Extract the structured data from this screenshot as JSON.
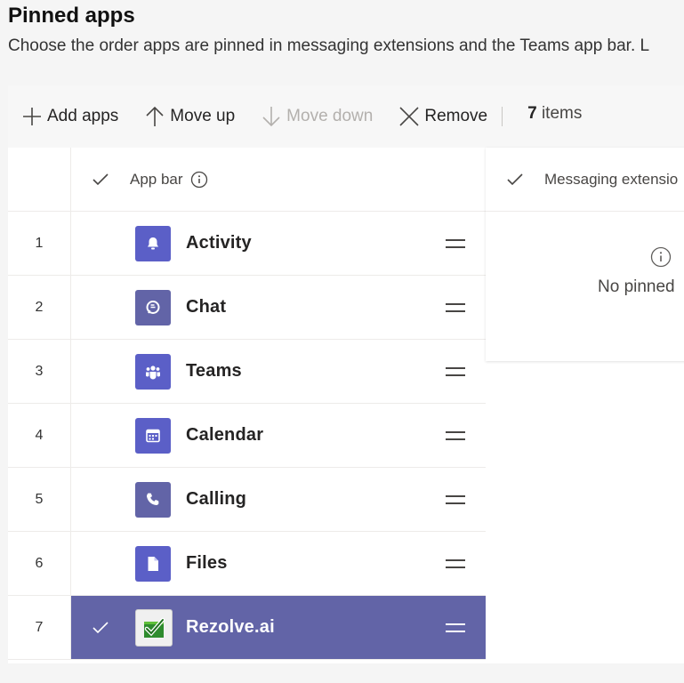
{
  "header": {
    "title": "Pinned apps",
    "subtitle": "Choose the order apps are pinned in messaging extensions and the Teams app bar. L"
  },
  "toolbar": {
    "add_label": "Add apps",
    "move_up_label": "Move up",
    "move_down_label": "Move down",
    "remove_label": "Remove",
    "count_number": "7",
    "count_suffix": " items"
  },
  "app_bar": {
    "column_label": "App bar",
    "rows": [
      {
        "num": "1",
        "name": "Activity",
        "icon": "bell-icon"
      },
      {
        "num": "2",
        "name": "Chat",
        "icon": "chat-bubble-icon"
      },
      {
        "num": "3",
        "name": "Teams",
        "icon": "teams-people-icon"
      },
      {
        "num": "4",
        "name": "Calendar",
        "icon": "calendar-icon"
      },
      {
        "num": "5",
        "name": "Calling",
        "icon": "phone-icon"
      },
      {
        "num": "6",
        "name": "Files",
        "icon": "file-icon"
      },
      {
        "num": "7",
        "name": "Rezolve.ai",
        "icon": "rezolve-logo-icon",
        "selected": true
      }
    ]
  },
  "messaging_extensions": {
    "column_label": "Messaging extensio",
    "empty_text": "No pinned"
  },
  "colors": {
    "accent": "#6264a7",
    "icon_bg": "#5b5fc7"
  }
}
